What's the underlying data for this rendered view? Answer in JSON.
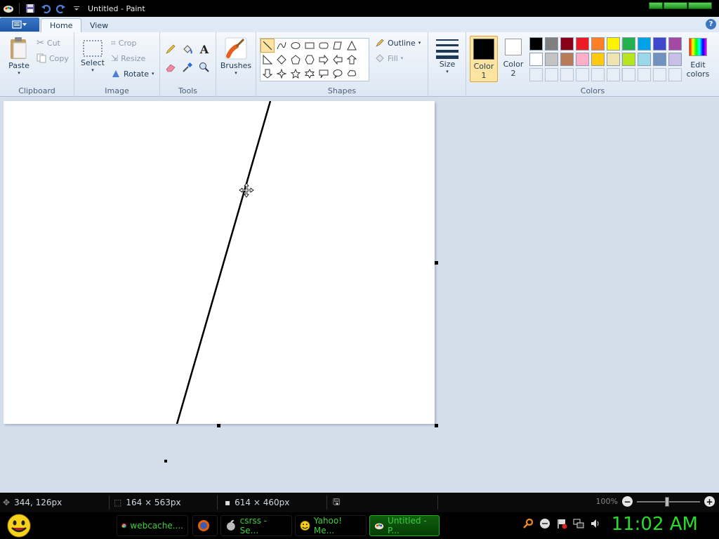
{
  "window": {
    "title": "Untitled - Paint"
  },
  "tabs": {
    "home": "Home",
    "view": "View"
  },
  "clipboard": {
    "paste": "Paste",
    "cut": "Cut",
    "copy": "Copy",
    "group": "Clipboard"
  },
  "image": {
    "select": "Select",
    "crop": "Crop",
    "resize": "Resize",
    "rotate": "Rotate",
    "group": "Image"
  },
  "tools": {
    "group": "Tools"
  },
  "brushes": {
    "label": "Brushes"
  },
  "shapes": {
    "outline": "Outline",
    "fill": "Fill",
    "group": "Shapes"
  },
  "size": {
    "label": "Size"
  },
  "colors": {
    "color1_line1": "Color",
    "color1_line2": "1",
    "color2_line1": "Color",
    "color2_line2": "2",
    "edit_line1": "Edit",
    "edit_line2": "colors",
    "group": "Colors",
    "color1": "#000000",
    "color2": "#ffffff",
    "palette_row1": [
      "#000000",
      "#7f7f7f",
      "#880015",
      "#ed1c24",
      "#ff7f27",
      "#fff200",
      "#22b14c",
      "#00a2e8",
      "#3f48cc",
      "#a349a4"
    ],
    "palette_row2": [
      "#ffffff",
      "#c3c3c3",
      "#b97a57",
      "#ffaec9",
      "#ffc90e",
      "#efe4b0",
      "#b5e61d",
      "#99d9ea",
      "#7092be",
      "#c8bfe7"
    ]
  },
  "status": {
    "cursor_pos": "344, 126px",
    "selection_size": "164 × 563px",
    "canvas_size": "614 × 460px",
    "zoom": "100%"
  },
  "taskbar": {
    "items": [
      {
        "label": "webcache....",
        "icon": "chrome-icon"
      },
      {
        "label": "",
        "icon": "firefox-icon"
      },
      {
        "label": "csrss - Se...",
        "icon": "process-icon"
      },
      {
        "label": "Yahoo! Me...",
        "icon": "yahoo-messenger-icon"
      },
      {
        "label": "Untitled - P...",
        "icon": "paint-icon"
      }
    ],
    "clock": "11:02 AM"
  }
}
